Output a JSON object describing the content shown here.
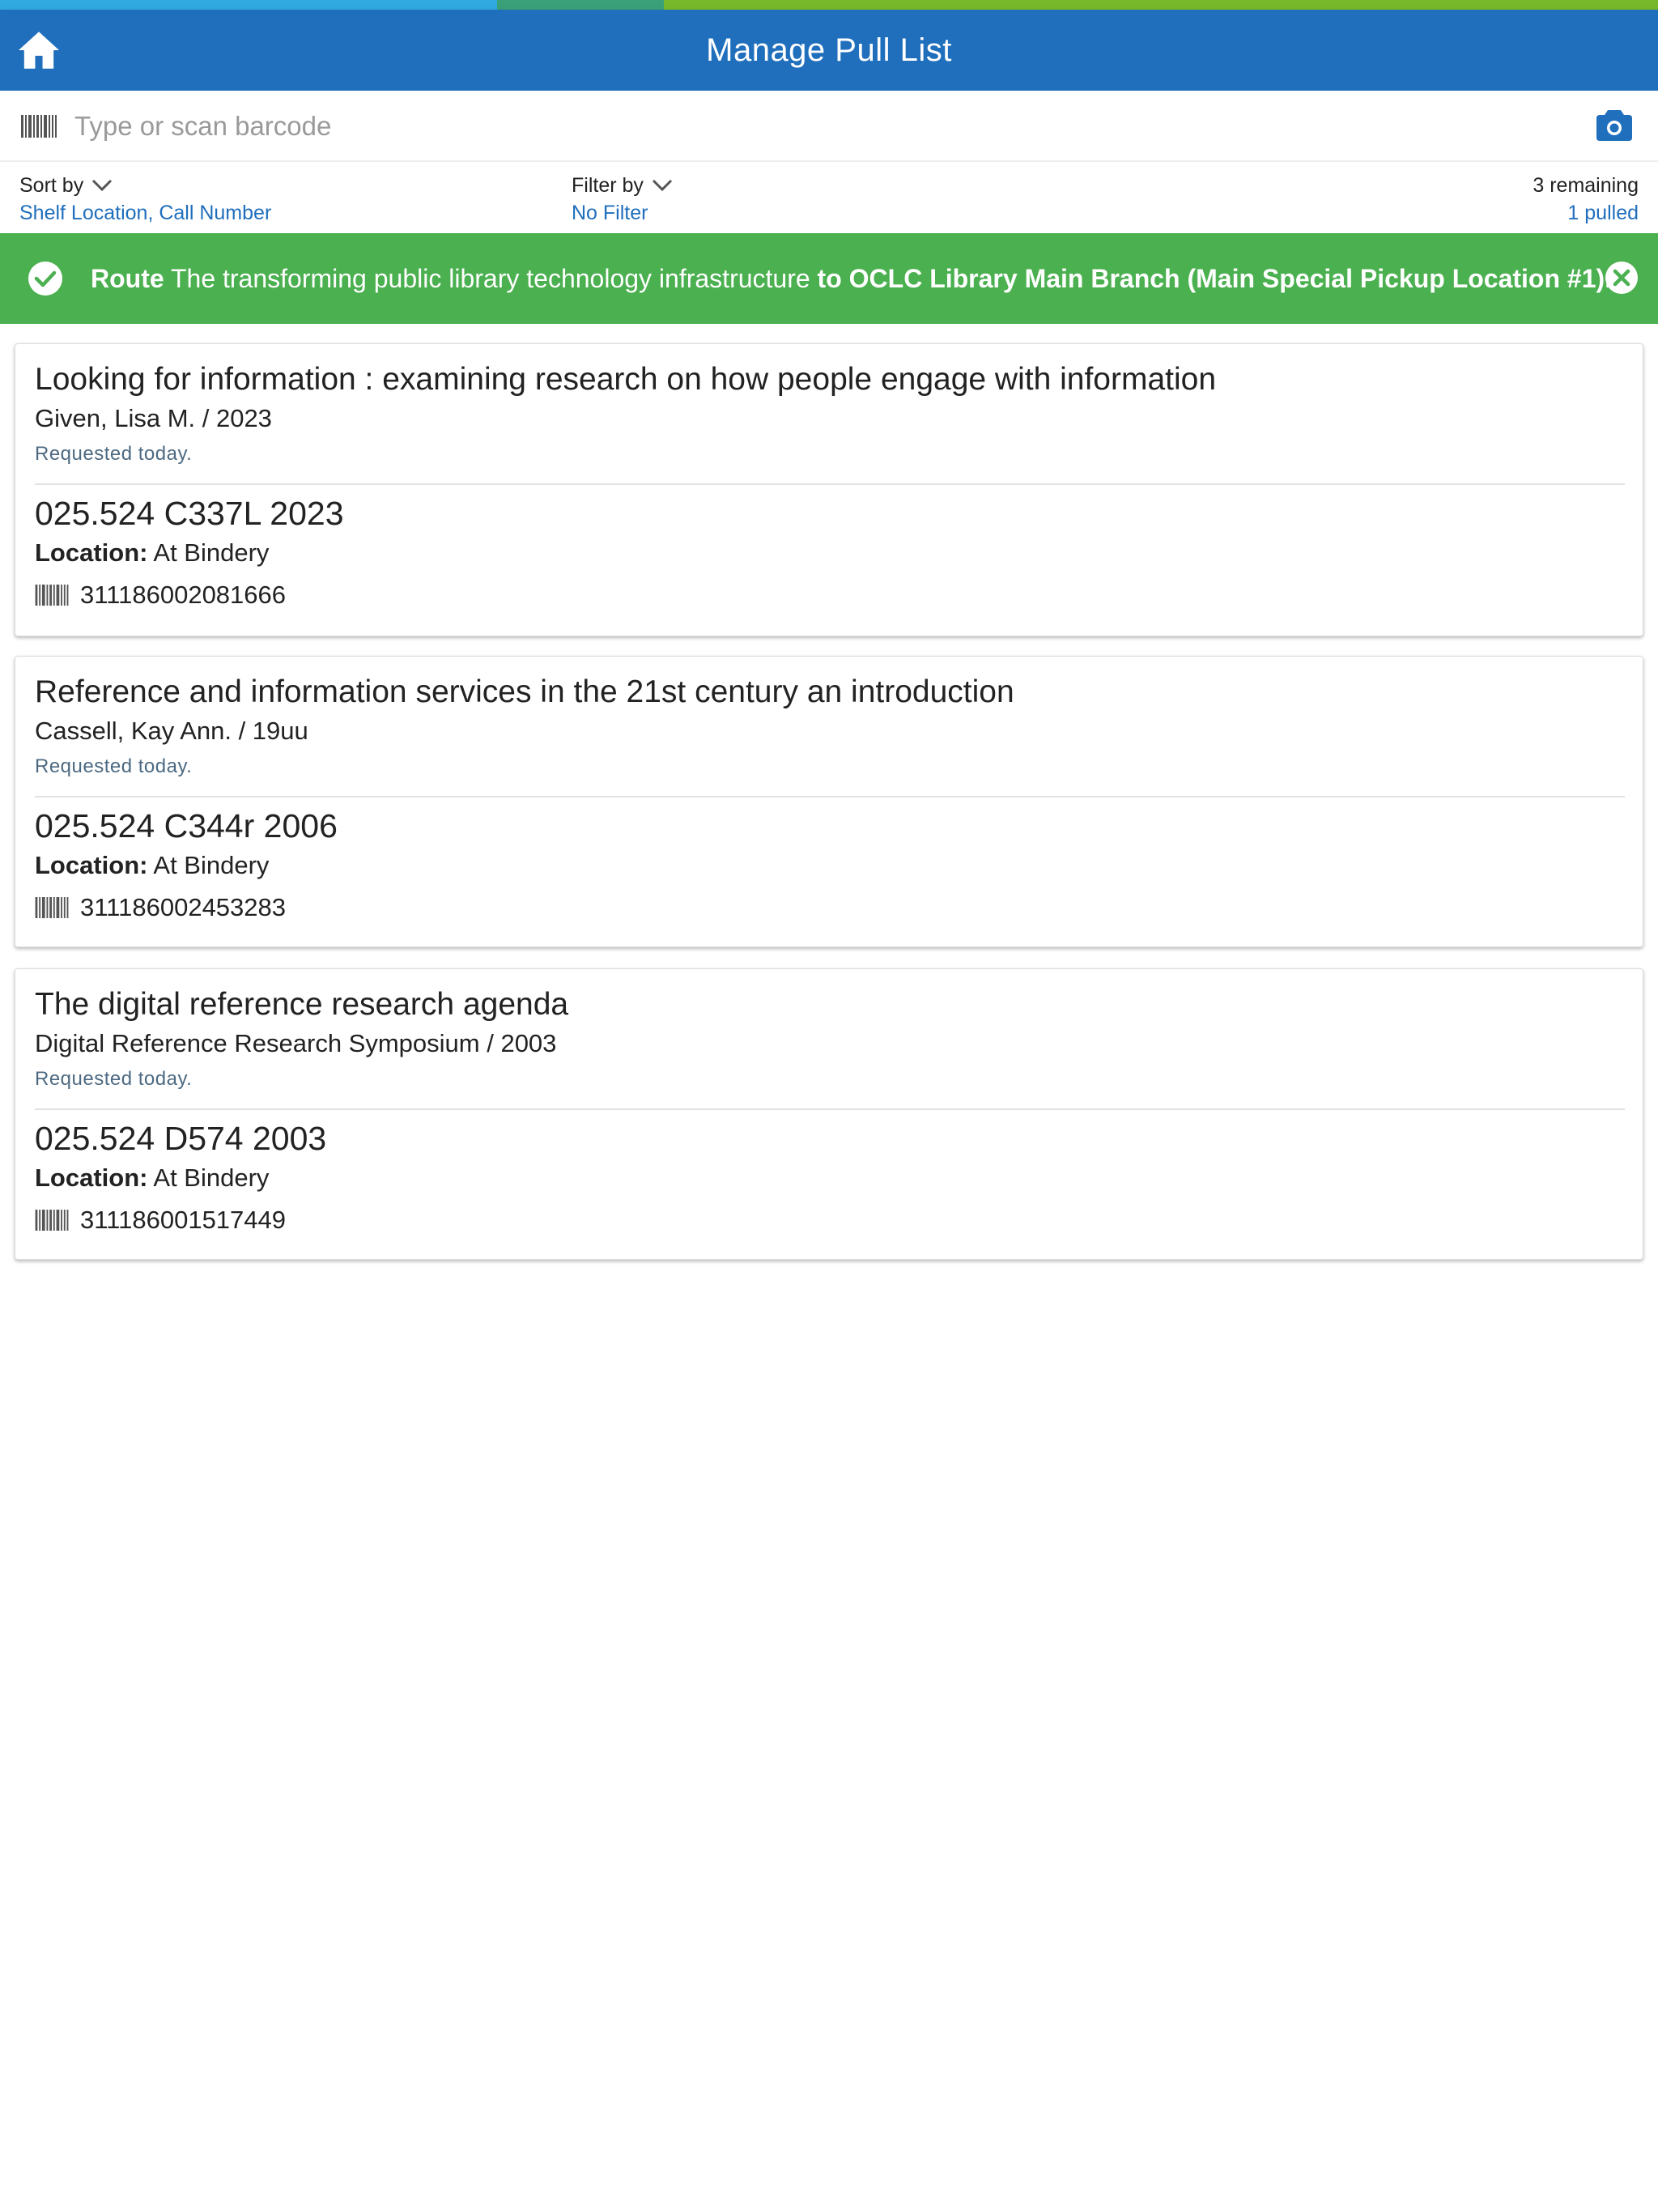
{
  "header": {
    "title": "Manage Pull List",
    "home_icon": "home-icon"
  },
  "colors": {
    "header": "#206fbc",
    "accent_blue": "#30a8e0",
    "accent_teal": "#3aa07a",
    "accent_green": "#76b82a",
    "banner": "#4bb04f",
    "link": "#206fbc"
  },
  "search": {
    "placeholder": "Type or scan barcode",
    "value": "",
    "barcode_icon": "barcode-icon",
    "camera_icon": "camera-icon"
  },
  "controls": {
    "sort_label": "Sort by",
    "sort_value": "Shelf Location, Call Number",
    "filter_label": "Filter by",
    "filter_value": "No Filter",
    "remaining": "3 remaining",
    "pulled": "1 pulled"
  },
  "banner": {
    "prefix": "Route",
    "item_title": "The transforming public library technology infrastructure",
    "destination": "to OCLC Library Main Branch (Main Special Pickup Location #1).",
    "check_icon": "check-circle-icon",
    "close_icon": "close-circle-icon"
  },
  "items": [
    {
      "title": "Looking for information : examining research on how people engage with information",
      "author_year": "Given, Lisa M. / 2023",
      "requested": "Requested today.",
      "call_number": "025.524 C337L 2023",
      "location_label": "Location:",
      "location": "At Bindery",
      "barcode": "311186002081666"
    },
    {
      "title": "Reference and information services in the 21st century an introduction",
      "author_year": "Cassell, Kay Ann. / 19uu",
      "requested": "Requested today.",
      "call_number": "025.524 C344r 2006",
      "location_label": "Location:",
      "location": "At Bindery",
      "barcode": "311186002453283"
    },
    {
      "title": "The digital reference research agenda",
      "author_year": "Digital Reference Research Symposium / 2003",
      "requested": "Requested today.",
      "call_number": "025.524 D574 2003",
      "location_label": "Location:",
      "location": "At Bindery",
      "barcode": "311186001517449"
    }
  ]
}
